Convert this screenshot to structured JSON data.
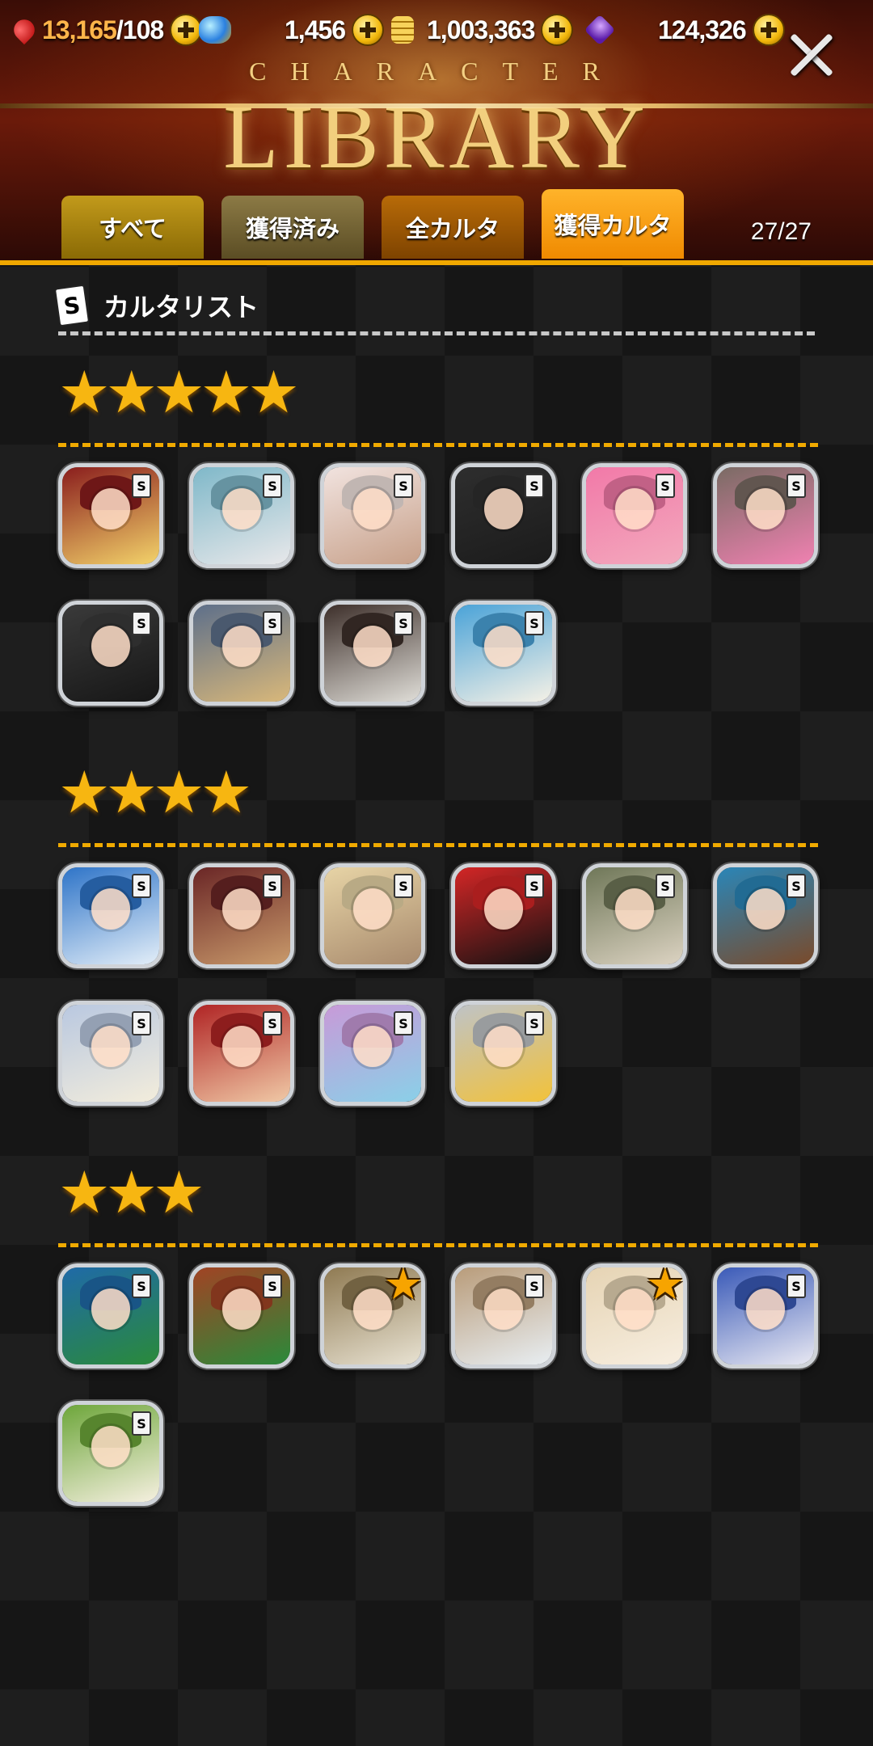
{
  "resources": {
    "stamina_current": "13,165",
    "stamina_max": "/108",
    "orbs": "1,456",
    "coins": "1,003,363",
    "gems": "124,326",
    "colors": {
      "stamina": "#d92020",
      "orbs": "#3aa0e8",
      "coins": "#e8b51a",
      "gems": "#7a3ac8"
    }
  },
  "header": {
    "subtitle": "CHARACTER",
    "title": "LIBRARY",
    "close_icon": "close-icon"
  },
  "tabs": [
    {
      "label": "すべて"
    },
    {
      "label": "獲得済み"
    },
    {
      "label": "全カルタ"
    },
    {
      "label": "獲得カルタ",
      "active": true
    }
  ],
  "count": "27/27",
  "list": {
    "icon_letter": "S",
    "label": "カルタリスト"
  },
  "groups": [
    {
      "rarity_stars": 5,
      "stars_text": "★★★★★",
      "cards": [
        {
          "badge": "S",
          "colors": [
            "#8a1d1d",
            "#f3d36a"
          ]
        },
        {
          "badge": "S",
          "colors": [
            "#7fb8c9",
            "#e8e8ea"
          ]
        },
        {
          "badge": "S",
          "colors": [
            "#f1e3df",
            "#c7a089"
          ]
        },
        {
          "badge": "S",
          "colors": [
            "#2e2e2e",
            "#1b1b1b"
          ]
        },
        {
          "badge": "S",
          "colors": [
            "#f279a8",
            "#f3a9bd"
          ]
        },
        {
          "badge": "S",
          "colors": [
            "#7a6b64",
            "#f081b1"
          ]
        },
        {
          "badge": "S",
          "colors": [
            "#3a3a3a",
            "#161616"
          ]
        },
        {
          "badge": "S",
          "colors": [
            "#5d6f8a",
            "#d9b87a"
          ]
        },
        {
          "badge": "S",
          "colors": [
            "#3d2f2a",
            "#e0ded8"
          ]
        },
        {
          "badge": "S",
          "colors": [
            "#4aa3d8",
            "#f5f1e6"
          ]
        }
      ]
    },
    {
      "rarity_stars": 4,
      "stars_text": "★★★★",
      "cards": [
        {
          "badge": "S",
          "colors": [
            "#2e74c8",
            "#e3eef8"
          ]
        },
        {
          "badge": "S",
          "colors": [
            "#6a2626",
            "#c99a6b"
          ]
        },
        {
          "badge": "S",
          "colors": [
            "#e7d4a6",
            "#a88a6d"
          ]
        },
        {
          "badge": "S",
          "colors": [
            "#d42626",
            "#121212"
          ]
        },
        {
          "badge": "S",
          "colors": [
            "#6f7758",
            "#dcd3c2"
          ]
        },
        {
          "badge": "S",
          "colors": [
            "#2a86b8",
            "#7a4a2a"
          ]
        },
        {
          "badge": "S",
          "colors": [
            "#b9c8e0",
            "#f3eddc"
          ]
        },
        {
          "badge": "S",
          "colors": [
            "#b02424",
            "#f0c9a6"
          ]
        },
        {
          "badge": "S",
          "colors": [
            "#c89ad8",
            "#8ad0e8"
          ]
        },
        {
          "badge": "S",
          "colors": [
            "#bfc3c6",
            "#f2c23a"
          ]
        }
      ]
    },
    {
      "rarity_stars": 3,
      "stars_text": "★★★",
      "cards": [
        {
          "badge": "S",
          "colors": [
            "#1f6aa8",
            "#2a8a3a"
          ]
        },
        {
          "badge": "S",
          "colors": [
            "#a14324",
            "#2a8a3a"
          ]
        },
        {
          "badge": "★",
          "colors": [
            "#8f7a52",
            "#e8e2d2"
          ],
          "star_badge": true
        },
        {
          "badge": "S",
          "colors": [
            "#b99c7a",
            "#e8eef2"
          ]
        },
        {
          "badge": "★",
          "colors": [
            "#e6d4b4",
            "#f7eee0"
          ],
          "star_badge": true
        },
        {
          "badge": "S",
          "colors": [
            "#3a5ab8",
            "#e8e8f2"
          ]
        },
        {
          "badge": "S",
          "colors": [
            "#6da63a",
            "#f6f0e0"
          ]
        }
      ]
    }
  ]
}
